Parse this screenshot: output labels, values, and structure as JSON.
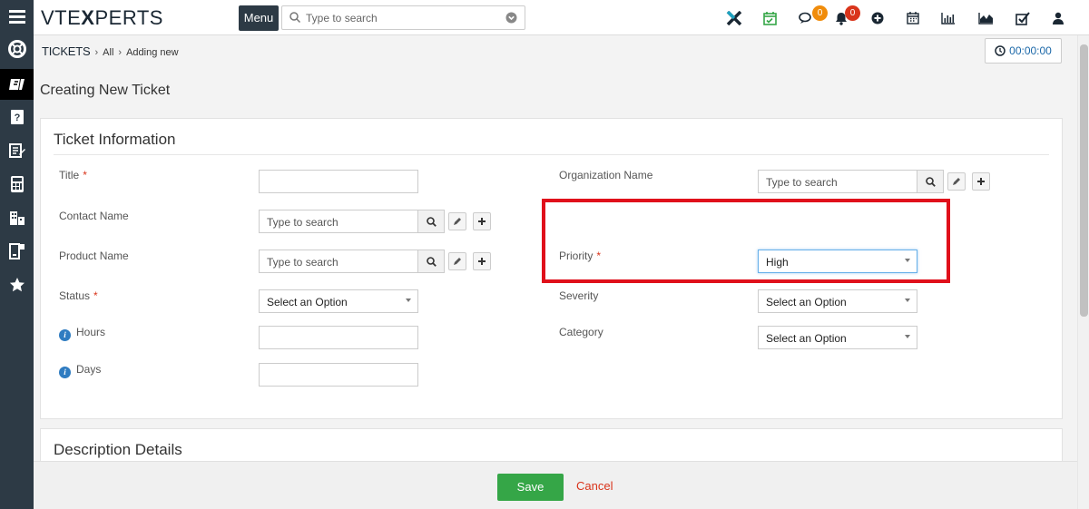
{
  "header": {
    "logo_pre": "VTE",
    "logo_x": "X",
    "logo_post": "PERTS",
    "menu_label": "Menu",
    "search_placeholder": "Type to search",
    "chat_count": "0",
    "notif_count": "0"
  },
  "breadcrumb": {
    "module": "TICKETS",
    "filter": "All",
    "current": "Adding new"
  },
  "timer": "00:00:00",
  "page_title": "Creating New Ticket",
  "section1": {
    "title": "Ticket Information",
    "fields": {
      "title": {
        "label": "Title",
        "value": ""
      },
      "organization": {
        "label": "Organization Name",
        "placeholder": "Type to search"
      },
      "contact": {
        "label": "Contact Name",
        "placeholder": "Type to search"
      },
      "product": {
        "label": "Product Name",
        "placeholder": "Type to search"
      },
      "priority": {
        "label": "Priority",
        "value": "High"
      },
      "status": {
        "label": "Status",
        "value": "Select an Option"
      },
      "severity": {
        "label": "Severity",
        "value": "Select an Option"
      },
      "hours": {
        "label": "Hours",
        "value": ""
      },
      "category": {
        "label": "Category",
        "value": "Select an Option"
      },
      "days": {
        "label": "Days",
        "value": ""
      }
    },
    "required_mark": "*",
    "info_mark": "i"
  },
  "section2": {
    "title": "Description Details"
  },
  "footer": {
    "save_label": "Save",
    "cancel_label": "Cancel"
  },
  "colors": {
    "sidebar": "#2d3a45",
    "save": "#35a647",
    "cancel": "#d9341b",
    "highlight": "#e0101b",
    "required": "#d9341b"
  }
}
